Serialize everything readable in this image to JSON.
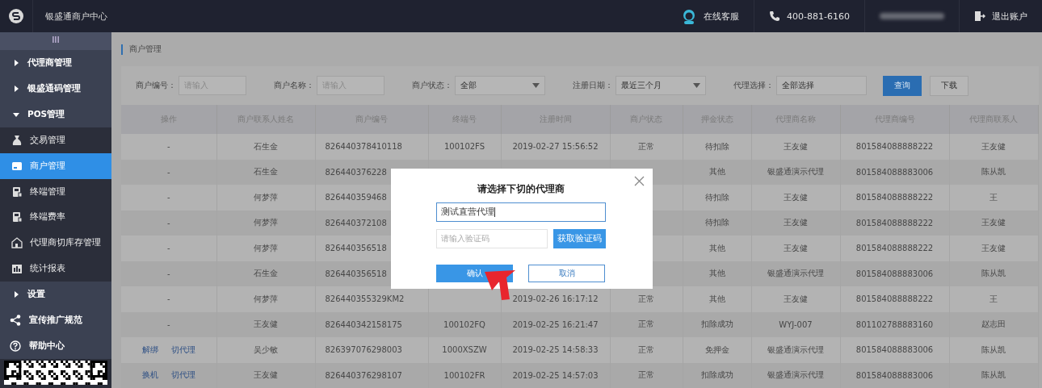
{
  "header": {
    "title": "银盛通商户中心",
    "service": "在线客服",
    "phone": "400-881-6160",
    "logout": "退出账户"
  },
  "sidebar": {
    "toggle": "III",
    "items": [
      {
        "kind": "group",
        "label": "代理商管理",
        "expanded": false
      },
      {
        "kind": "group",
        "label": "银盛通码管理",
        "expanded": false
      },
      {
        "kind": "group",
        "label": "POS管理",
        "expanded": true,
        "children": [
          {
            "label": "交易管理",
            "selected": false
          },
          {
            "label": "商户管理",
            "selected": true
          },
          {
            "label": "终端管理",
            "selected": false
          },
          {
            "label": "终端费率",
            "selected": false
          },
          {
            "label": "代理商切库存管理",
            "selected": false
          },
          {
            "label": "统计报表",
            "selected": false
          }
        ]
      },
      {
        "kind": "group",
        "label": "设置",
        "expanded": false
      },
      {
        "kind": "link",
        "label": "宣传推广规范",
        "selected": false
      },
      {
        "kind": "link",
        "label": "帮助中心",
        "selected": false
      }
    ]
  },
  "breadcrumb": "商户管理",
  "filters": [
    {
      "kind": "text",
      "label": "商户编号：",
      "placeholder": "请输入"
    },
    {
      "kind": "text",
      "label": "商户名称：",
      "placeholder": "请输入"
    },
    {
      "kind": "select",
      "label": "商户状态：",
      "value": "全部"
    },
    {
      "kind": "select",
      "label": "注册日期：",
      "value": "最近三个月"
    },
    {
      "kind": "text",
      "label": "代理选择：",
      "value": "全部选择"
    }
  ],
  "buttons": [
    {
      "label": "查询",
      "primary": true
    },
    {
      "label": "下载",
      "primary": false
    }
  ],
  "table": {
    "columns": [
      "操作",
      "商户联系人姓名",
      "商户编号",
      "终端号",
      "注册时间",
      "商户状态",
      "押金状态",
      "代理商名称",
      "代理商编号",
      "代理商联系人"
    ],
    "rows": [
      {
        "cells": [
          "-",
          "石生金",
          "826440378410118",
          "100102FS",
          "2019-02-27 15:56:52",
          "正常",
          "待扣除",
          "王友健",
          "801584088888222",
          "王友健"
        ]
      },
      {
        "cells": [
          "-",
          "石生金",
          "826440376228",
          null,
          null,
          null,
          "其他",
          "银盛通演示代理",
          "801584088883006",
          "陈从凯"
        ]
      },
      {
        "cells": [
          "-",
          "何梦萍",
          "826440359468",
          null,
          null,
          null,
          "待扣除",
          "王友健",
          "801584088888222",
          "王"
        ]
      },
      {
        "cells": [
          "-",
          "何梦萍",
          "826440372108",
          null,
          null,
          null,
          "待扣除",
          "王友健",
          "801584088888222",
          "王友健"
        ]
      },
      {
        "cells": [
          "-",
          "何梦萍",
          "826440356518",
          null,
          null,
          null,
          "其他",
          "王友健",
          "801584088888222",
          "王友健"
        ]
      },
      {
        "cells": [
          "-",
          "石生金",
          "826440356518",
          null,
          null,
          null,
          "其他",
          "银盛通演示代理",
          "801584088883006",
          "陈从凯"
        ]
      },
      {
        "cells": [
          "-",
          "何梦萍",
          "826440355329KM2",
          null,
          "2019-02-26 16:17:12",
          "正常",
          "其他",
          "王友健",
          "801584088888222",
          "王"
        ]
      },
      {
        "cells": [
          "-",
          "王友健",
          "826440342158175",
          "100102FQ",
          "2019-02-25 16:21:47",
          "正常",
          "扣除成功",
          "WYJ-007",
          "801102788883160",
          "赵志田"
        ]
      },
      {
        "cells": [
          [
            "解绑",
            "切代理"
          ],
          "吴少敏",
          "826397076298003",
          "1000XSZW",
          "2019-02-25 14:58:33",
          "正常",
          "免押金",
          "银盛通演示代理",
          "801584088883006",
          "陈从凯"
        ]
      },
      {
        "cells": [
          [
            "换机",
            "切代理"
          ],
          "王友健",
          "826440376298107",
          "100102FR",
          "2019-02-25 14:57:03",
          "正常",
          "扣除成功",
          "银盛通演示代理",
          "801584088883006",
          "陈从凯"
        ]
      }
    ]
  },
  "dialog": {
    "title": "请选择下切的代理商",
    "agent_value": "测试直营代理",
    "code_placeholder": "请输入验证码",
    "code_button": "获取验证码",
    "confirm": "确认",
    "cancel": "取消"
  }
}
